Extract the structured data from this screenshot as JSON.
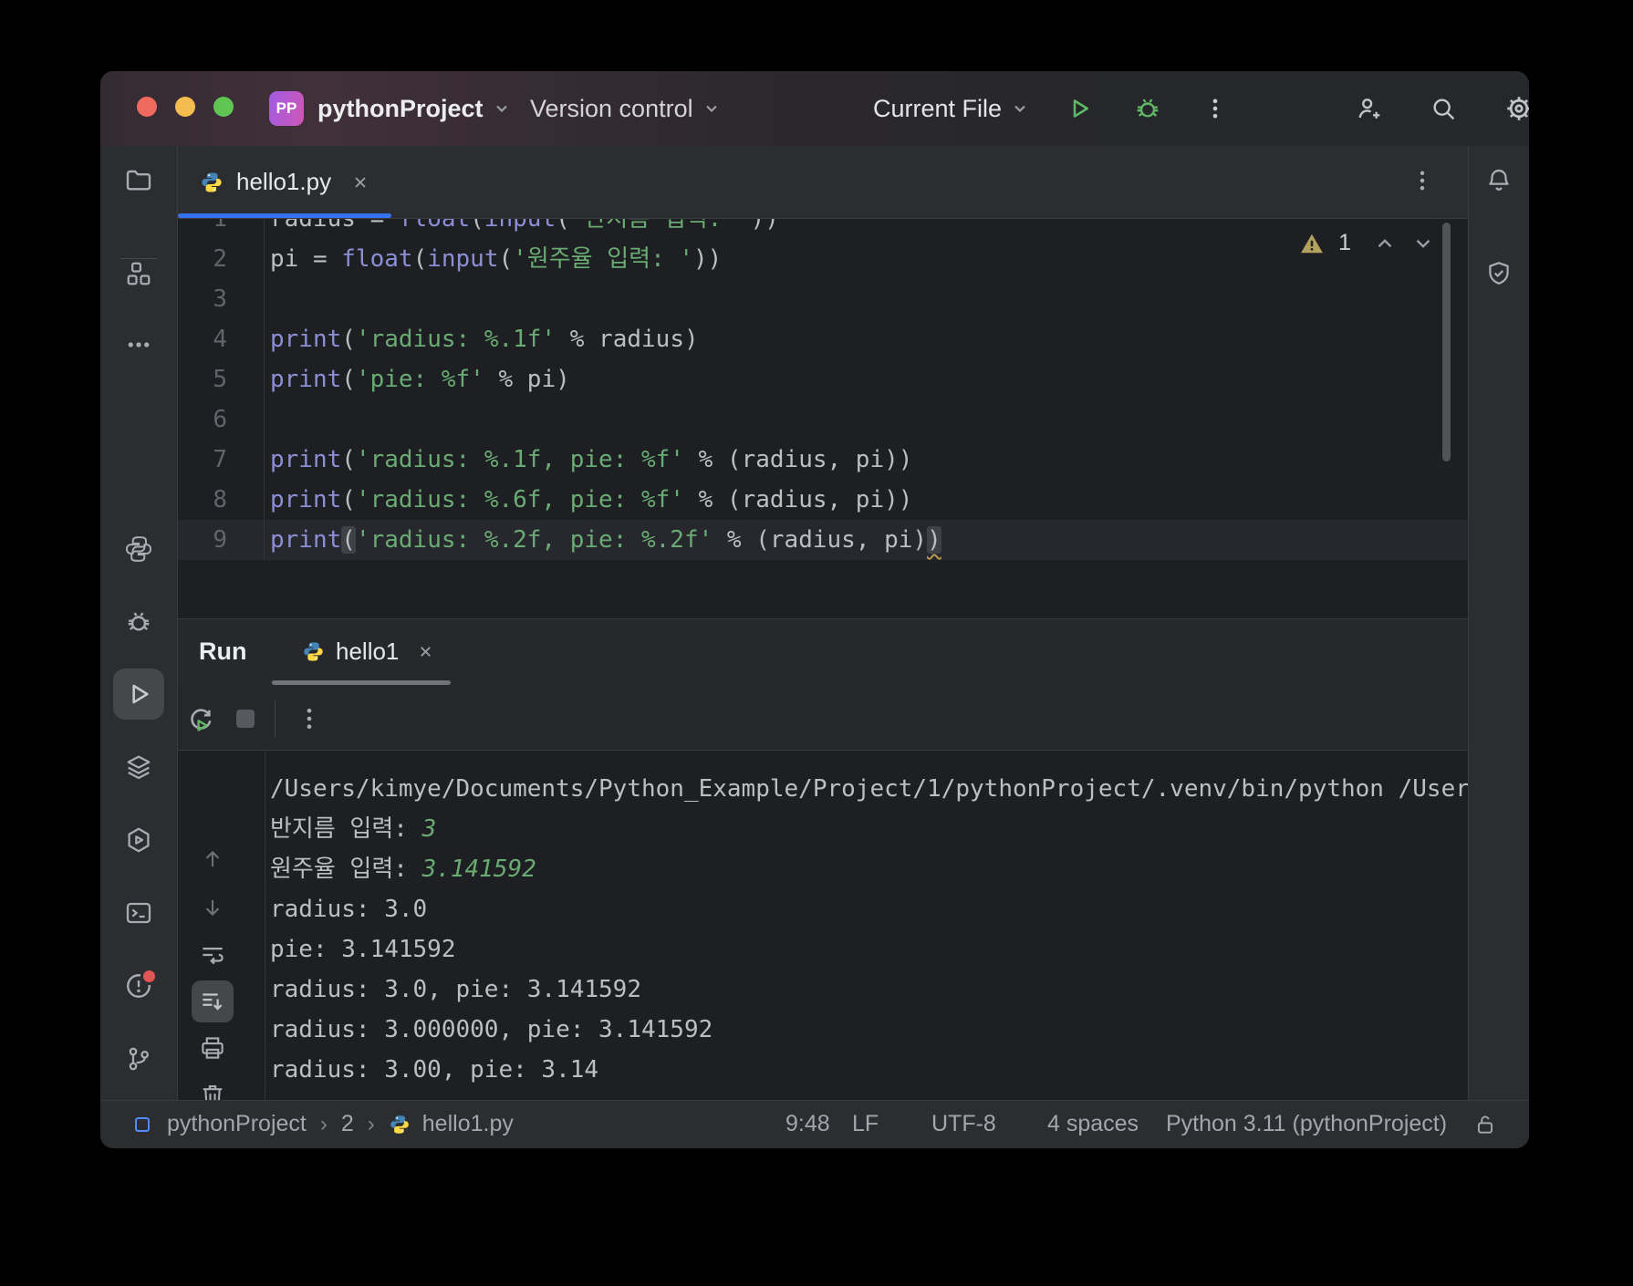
{
  "titlebar": {
    "badge": "PP",
    "project": "pythonProject",
    "vcs_menu": "Version control",
    "run_config": "Current File",
    "icons": [
      "run-icon",
      "debug-icon",
      "more-icon",
      "add-user-icon",
      "search-icon",
      "settings-icon"
    ]
  },
  "sidebar_left": {
    "icons": [
      "project-folder",
      "structure",
      "more",
      "python-packages",
      "debug",
      "run-selected",
      "layers",
      "services",
      "terminal",
      "problems",
      "git"
    ]
  },
  "sidebar_right": {
    "icons": [
      "notifications-bell",
      "shield"
    ]
  },
  "editor_tab": {
    "label": "hello1.py",
    "close": "×"
  },
  "editor": {
    "warning_count": "1",
    "lines": [
      {
        "n": "1",
        "tokens": [
          [
            "radius = ",
            "plain"
          ],
          [
            "float",
            "fn"
          ],
          [
            "(",
            "plain"
          ],
          [
            "input",
            "fn"
          ],
          [
            "(",
            "plain"
          ],
          [
            "'반지름 입력: '",
            "str"
          ],
          [
            "))",
            "plain"
          ]
        ]
      },
      {
        "n": "2",
        "tokens": [
          [
            "pi = ",
            "plain"
          ],
          [
            "float",
            "fn"
          ],
          [
            "(",
            "plain"
          ],
          [
            "input",
            "fn"
          ],
          [
            "(",
            "plain"
          ],
          [
            "'원주율 입력: '",
            "str"
          ],
          [
            "))",
            "plain"
          ]
        ]
      },
      {
        "n": "3",
        "tokens": []
      },
      {
        "n": "4",
        "tokens": [
          [
            "print",
            "fn"
          ],
          [
            "(",
            "plain"
          ],
          [
            "'radius: %.1f'",
            "str"
          ],
          [
            " % radius)",
            "plain"
          ]
        ]
      },
      {
        "n": "5",
        "tokens": [
          [
            "print",
            "fn"
          ],
          [
            "(",
            "plain"
          ],
          [
            "'pie: %f'",
            "str"
          ],
          [
            " % pi)",
            "plain"
          ]
        ]
      },
      {
        "n": "6",
        "tokens": []
      },
      {
        "n": "7",
        "tokens": [
          [
            "print",
            "fn"
          ],
          [
            "(",
            "plain"
          ],
          [
            "'radius: %.1f, pie: %f'",
            "str"
          ],
          [
            " % (radius, pi))",
            "plain"
          ]
        ]
      },
      {
        "n": "8",
        "tokens": [
          [
            "print",
            "fn"
          ],
          [
            "(",
            "plain"
          ],
          [
            "'radius: %.6f, pie: %f'",
            "str"
          ],
          [
            " % (radius, pi))",
            "plain"
          ]
        ]
      },
      {
        "n": "9",
        "current": true,
        "tokens": [
          [
            "print",
            "fn"
          ],
          [
            "(",
            "brace"
          ],
          [
            "'radius: %.2f, pie: %.2f'",
            "str"
          ],
          [
            " % (radius, pi)",
            "plain"
          ],
          [
            ")",
            "bracew"
          ]
        ]
      }
    ]
  },
  "run": {
    "panel_title": "Run",
    "tab": "hello1",
    "close": "×",
    "gutter_icons": [
      "up-arrow",
      "down-arrow",
      "soft-wrap",
      "scroll-to-end-selected",
      "print",
      "delete"
    ],
    "console": [
      [
        [
          "/Users/kimye/Documents/Python_Example/Project/1/pythonProject/.venv/bin/python /Users/",
          "plain"
        ]
      ],
      [
        [
          "반지름 입력: ",
          "plain"
        ],
        [
          "3",
          "input"
        ]
      ],
      [
        [
          "원주율 입력: ",
          "plain"
        ],
        [
          "3.141592",
          "input"
        ]
      ],
      [
        [
          "radius: 3.0",
          "plain"
        ]
      ],
      [
        [
          "pie: 3.141592",
          "plain"
        ]
      ],
      [
        [
          "radius: 3.0, pie: 3.141592",
          "plain"
        ]
      ],
      [
        [
          "radius: 3.000000, pie: 3.141592",
          "plain"
        ]
      ],
      [
        [
          "radius: 3.00, pie: 3.14",
          "plain"
        ]
      ]
    ]
  },
  "statusbar": {
    "crumbs": [
      "pythonProject",
      "2",
      "hello1.py"
    ],
    "items": [
      "9:48",
      "LF",
      "UTF-8",
      "4 spaces",
      "Python 3.11 (pythonProject)"
    ]
  },
  "colors": {
    "accent_blue": "#3574f0",
    "green": "#5fb865",
    "string_green": "#6aab73",
    "builtin_purple": "#8c8fd6",
    "warning_olive": "#b3a15e",
    "error_red": "#e05555",
    "badge_gradient_from": "#a05ce4",
    "badge_gradient_to": "#cf56b5",
    "python_blue": "#4584b6",
    "python_yellow": "#ffd845"
  }
}
